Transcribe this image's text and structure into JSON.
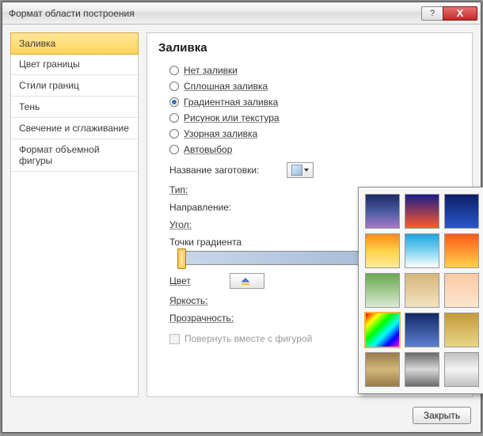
{
  "window": {
    "title": "Формат области построения"
  },
  "titlebar_buttons": {
    "help": "?",
    "close": "X"
  },
  "sidebar": {
    "items": [
      {
        "label": "Заливка",
        "active": true
      },
      {
        "label": "Цвет границы"
      },
      {
        "label": "Стили границ"
      },
      {
        "label": "Тень"
      },
      {
        "label": "Свечение и сглаживание"
      },
      {
        "label": "Формат объемной фигуры"
      }
    ]
  },
  "panel": {
    "heading": "Заливка",
    "fill_options": [
      {
        "label": "Нет заливки",
        "checked": false
      },
      {
        "label": "Сплошная заливка",
        "checked": false
      },
      {
        "label": "Градиентная заливка",
        "checked": true
      },
      {
        "label": "Рисунок или текстура",
        "checked": false
      },
      {
        "label": "Узорная заливка",
        "checked": false
      },
      {
        "label": "Автовыбор",
        "checked": false
      }
    ],
    "preset_label": "Название заготовки:",
    "type_label": "Тип:",
    "direction_label": "Направление:",
    "angle_label": "Угол:",
    "stops_label": "Точки градиента",
    "color_label": "Цвет",
    "brightness_label": "Яркость:",
    "transparency_label": "Прозрачность:",
    "rotate_with_shape": "Повернуть вместе с фигурой"
  },
  "palette": {
    "swatches": [
      {
        "css": "linear-gradient(180deg,#1a2a66,#4a5aa0,#a678c8)"
      },
      {
        "css": "linear-gradient(180deg,#1b1b8c,#ff5a2a)"
      },
      {
        "css": "linear-gradient(180deg,#0b1e66,#2a58c8)"
      },
      {
        "css": "linear-gradient(180deg,#cfe4ff,#e8f1ff)"
      },
      {
        "css": "linear-gradient(180deg,#e9e4d4,#d2c3a2,#bb9762)"
      },
      {
        "css": "linear-gradient(180deg,#ff8a1a,#ffd24a,#ffea99)"
      },
      {
        "css": "linear-gradient(180deg,#1fa3e0,#7fd3f0,#ffffff)"
      },
      {
        "css": "linear-gradient(180deg,#ff5a1a,#ffd24a)"
      },
      {
        "css": "linear-gradient(180deg,#ff3a1a,#ffcf33)"
      },
      {
        "css": "linear-gradient(180deg,#ffffff,#dddddd)"
      },
      {
        "css": "linear-gradient(180deg,#6aa84f,#d9ead3)"
      },
      {
        "css": "linear-gradient(180deg,#d7b57a,#f2e3c2)"
      },
      {
        "css": "linear-gradient(180deg,#f9c9a3,#fde6cf)"
      },
      {
        "css": "linear-gradient(180deg,#f4e5b8,#fff8e0)"
      },
      {
        "css": "linear-gradient(180deg,#f0e6d0,#e0d0a8)"
      },
      {
        "css": "linear-gradient(135deg,#ff0000,#ffff00,#00ff00,#00ffff,#0000ff,#ff00ff)",
        "selected": true
      },
      {
        "css": "linear-gradient(180deg,#112a66,#5f7fd0)"
      },
      {
        "css": "linear-gradient(180deg,#c49a3a,#e8d688)"
      },
      {
        "css": "linear-gradient(180deg,#b78b2a,#e2c35a,#b78b2a)"
      },
      {
        "css": "linear-gradient(180deg,#c49a3a,#f0dd9a,#c49a3a)"
      },
      {
        "css": "linear-gradient(180deg,#9a7a4a,#d0b87a,#9a7a4a)"
      },
      {
        "css": "linear-gradient(180deg,#6a6a6a,#d8d8d8,#6a6a6a)"
      },
      {
        "css": "linear-gradient(180deg,#c0c0c0,#f4f4f4,#c0c0c0)"
      },
      {
        "css": "repeating-linear-gradient(180deg,#0a2aa8 0 8px,#2a52e8 8px 16px)"
      }
    ]
  },
  "footer": {
    "close": "Закрыть"
  }
}
